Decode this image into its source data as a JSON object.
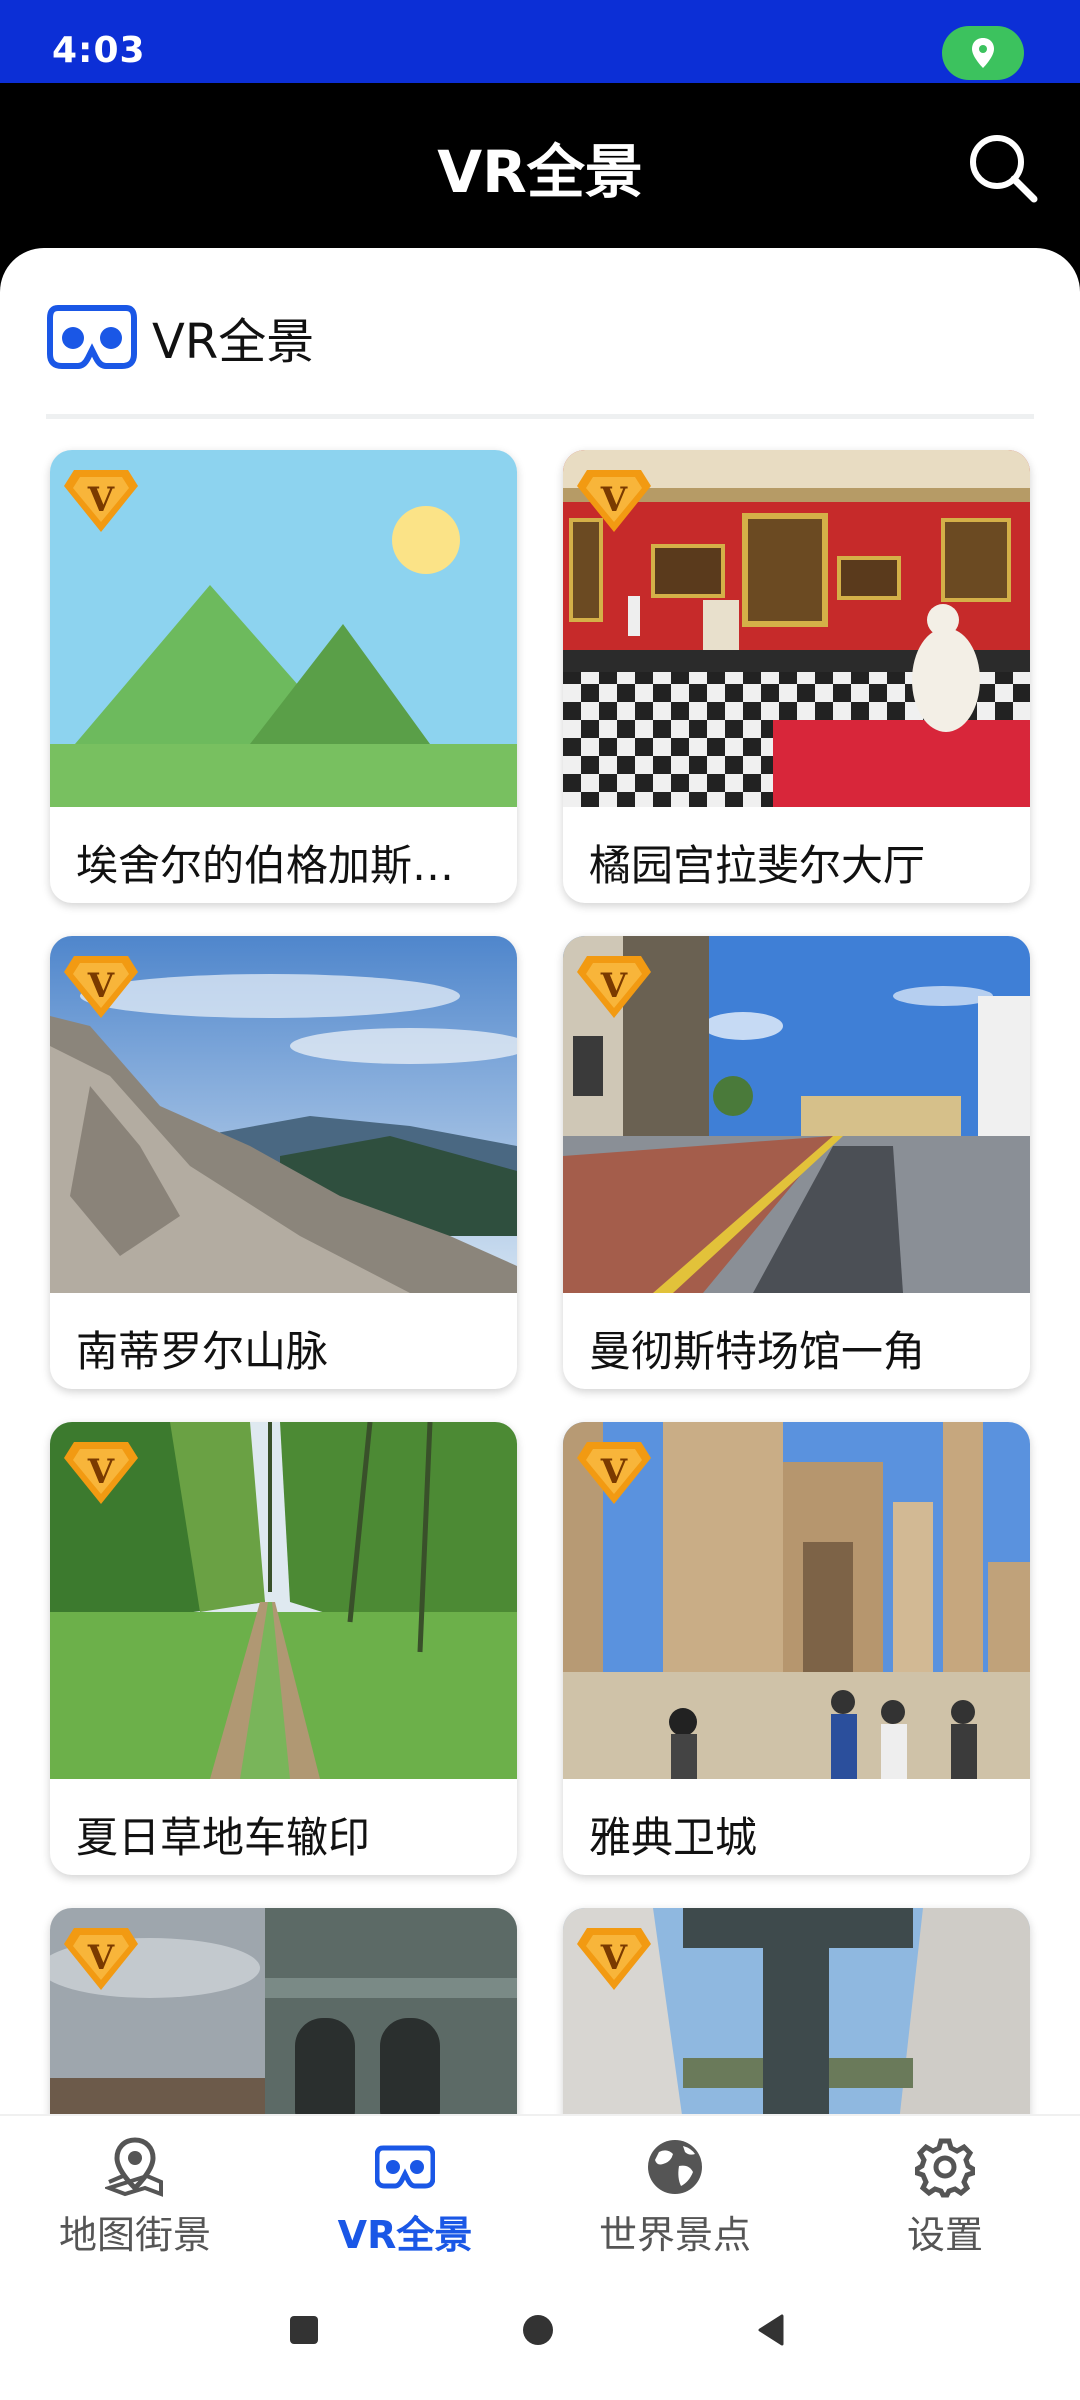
{
  "status": {
    "time": "4:03"
  },
  "app_bar": {
    "title": "VR全景"
  },
  "section": {
    "title": "VR全景"
  },
  "cards": [
    {
      "title": "埃舍尔的伯格加斯…"
    },
    {
      "title": "橘园宫拉斐尔大厅"
    },
    {
      "title": "南蒂罗尔山脉"
    },
    {
      "title": "曼彻斯特场馆一角"
    },
    {
      "title": "夏日草地车辙印"
    },
    {
      "title": "雅典卫城"
    },
    {
      "title": ""
    },
    {
      "title": ""
    }
  ],
  "nav": {
    "items": [
      {
        "label": "地图街景",
        "icon": "map-pin-icon"
      },
      {
        "label": "VR全景",
        "icon": "vr-goggles-icon",
        "active": true
      },
      {
        "label": "世界景点",
        "icon": "globe-icon"
      },
      {
        "label": "设置",
        "icon": "gear-icon"
      }
    ]
  },
  "colors": {
    "status_bar": "#0c2fd6",
    "accent": "#1a57e6",
    "badge": "#f29a12"
  }
}
